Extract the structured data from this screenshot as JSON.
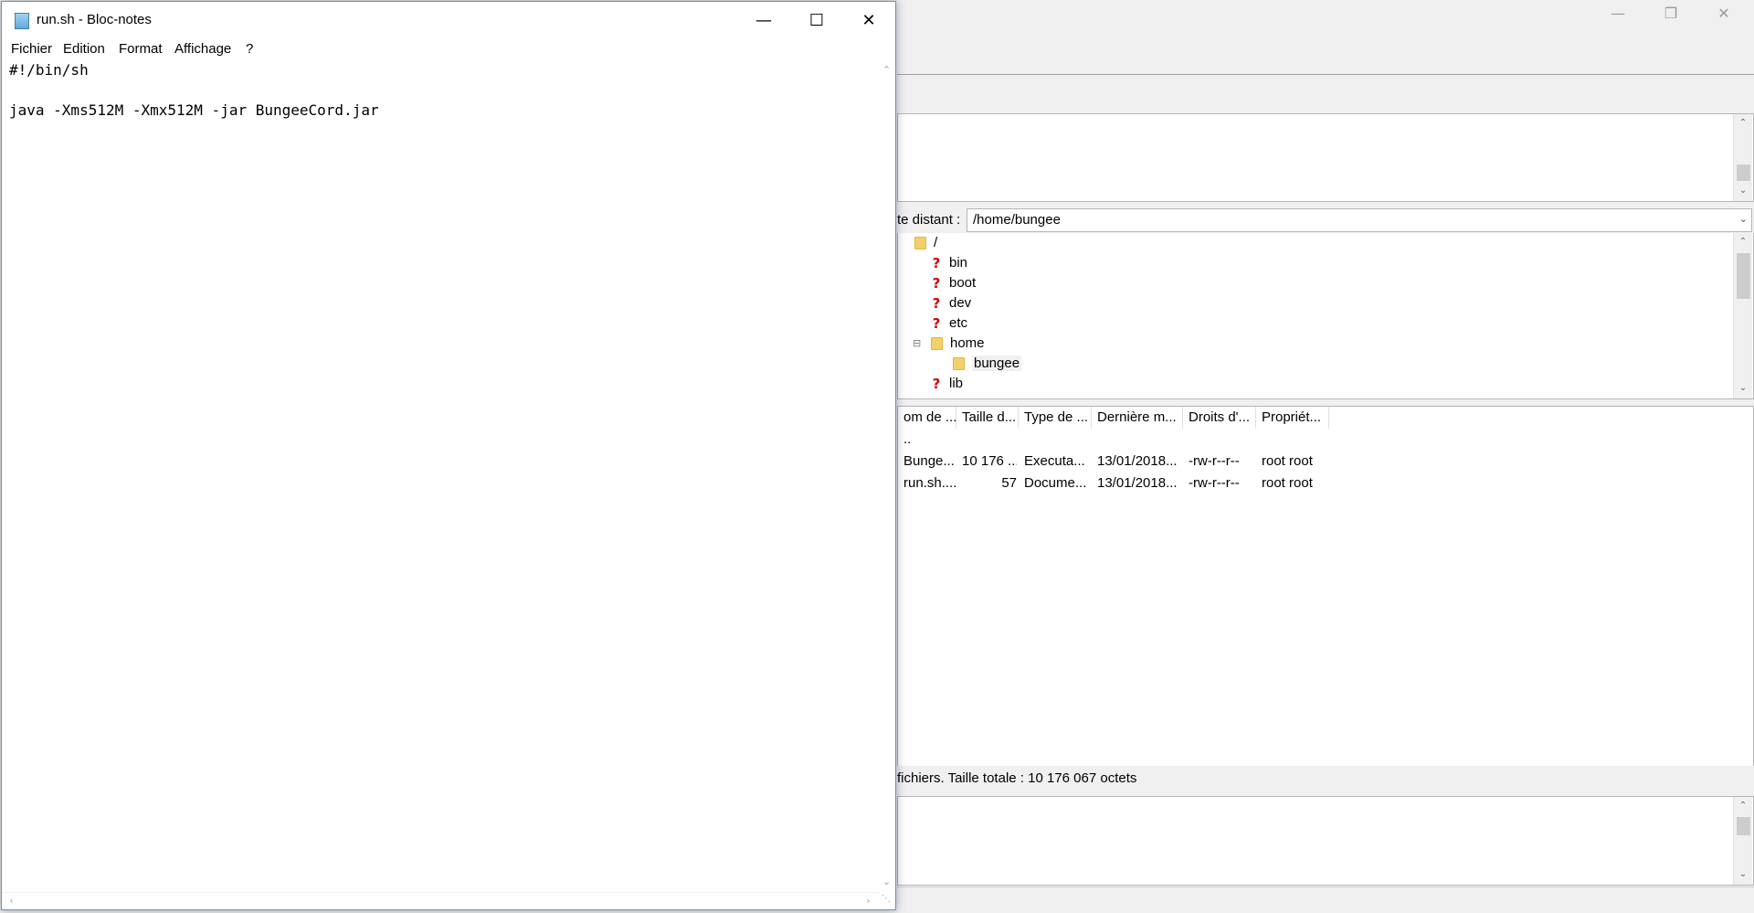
{
  "background_window": {
    "remote_site": {
      "label": "te distant :",
      "path": "/home/bungee"
    },
    "tree": [
      {
        "name": "/",
        "icon": "folder-icon",
        "level": 0
      },
      {
        "name": "bin",
        "icon": "question-icon",
        "level": 1
      },
      {
        "name": "boot",
        "icon": "question-icon",
        "level": 1
      },
      {
        "name": "dev",
        "icon": "question-icon",
        "level": 1
      },
      {
        "name": "etc",
        "icon": "question-icon",
        "level": 1
      },
      {
        "name": "home",
        "icon": "folder-icon",
        "level": 1
      },
      {
        "name": "bungee",
        "icon": "folder-icon",
        "level": 2
      },
      {
        "name": "lib",
        "icon": "question-icon",
        "level": 1
      }
    ],
    "file_list": {
      "columns": [
        "om de ...",
        "Taille d...",
        "Type de ...",
        "Dernière m...",
        "Droits d'...",
        "Propriét..."
      ],
      "rows": [
        {
          "name": "..",
          "size": "",
          "type": "",
          "modified": "",
          "perms": "",
          "owner": ""
        },
        {
          "name": "Bunge...",
          "size": "10 176 ...",
          "type": "Executa...",
          "modified": "13/01/2018...",
          "perms": "-rw-r--r--",
          "owner": "root root"
        },
        {
          "name": "run.sh....",
          "size": "57",
          "type": "Docume...",
          "modified": "13/01/2018...",
          "perms": "-rw-r--r--",
          "owner": "root root"
        }
      ]
    },
    "status": "fichiers. Taille totale : 10 176 067 octets"
  },
  "notepad": {
    "title": "run.sh - Bloc-notes",
    "menu": [
      "Fichier",
      "Edition",
      "Format",
      "Affichage",
      "?"
    ],
    "content": "#!/bin/sh\n\njava -Xms512M -Xmx512M -jar BungeeCord.jar"
  }
}
